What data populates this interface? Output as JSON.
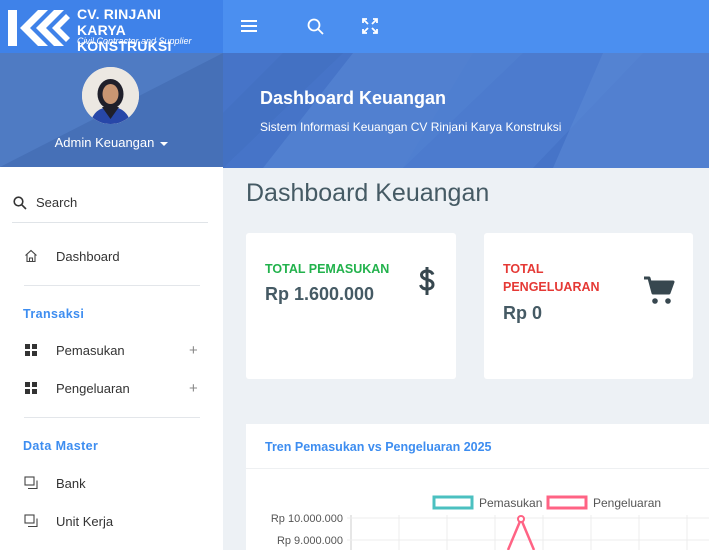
{
  "brand": {
    "title_line1": "CV. RINJANI",
    "title_line2": "KARYA KONSTRUKSI",
    "subtitle": "Civil Contractor and Supplier"
  },
  "topbar": {
    "icons": [
      "menu-icon",
      "search-icon",
      "fullscreen-icon"
    ]
  },
  "profile": {
    "name": "Admin Keuangan"
  },
  "sidebar": {
    "search_label": "Search",
    "dashboard_label": "Dashboard",
    "sections": [
      {
        "label": "Transaksi",
        "items": [
          "Pemasukan",
          "Pengeluaran"
        ]
      },
      {
        "label": "Data Master",
        "items": [
          "Bank",
          "Unit Kerja"
        ]
      }
    ]
  },
  "hero": {
    "title": "Dashboard Keuangan",
    "subtitle": "Sistem Informasi Keuangan CV Rinjani Karya Konstruksi"
  },
  "page_title": "Dashboard Keuangan",
  "cards": [
    {
      "label": "TOTAL PEMASUKAN",
      "value": "Rp 1.600.000",
      "color": "#22b24c",
      "icon": "dollar-icon"
    },
    {
      "label_line1": "TOTAL",
      "label_line2": "PENGELUARAN",
      "value": "Rp 0",
      "color": "#e53935",
      "icon": "cart-icon"
    }
  ],
  "colors": {
    "topbar": "#4b8ff0",
    "accent": "#3d8df0",
    "income": "#4bc0c0",
    "expense": "#ff6384"
  },
  "chart_data": {
    "type": "line",
    "title": "Tren Pemasukan vs Pengeluaran 2025",
    "series": [
      {
        "name": "Pemasukan"
      },
      {
        "name": "Pengeluaran"
      }
    ],
    "y_tick_labels": [
      "Rp 10.000.000",
      "Rp 9.000.000"
    ],
    "legend_position": "top"
  }
}
